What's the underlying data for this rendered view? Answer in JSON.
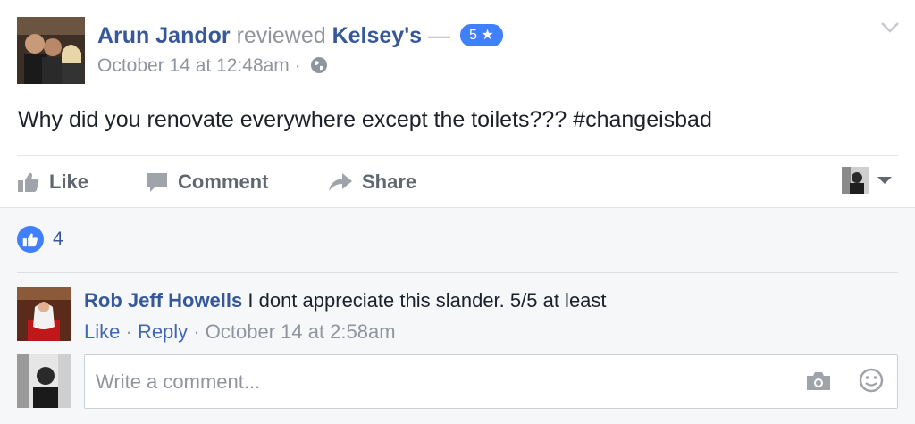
{
  "post": {
    "author": "Arun Jandor",
    "action": "reviewed",
    "place": "Kelsey's",
    "separator": "—",
    "rating": "5",
    "rating_icon": "star-icon",
    "timestamp": "October 14 at 12:48am",
    "meta_separator": "·",
    "audience_icon": "globe-icon",
    "text": "Why did you renovate everywhere except the toilets??? #changeisbad",
    "options_icon": "chevron-down-icon"
  },
  "actions": {
    "like": "Like",
    "comment": "Comment",
    "share": "Share"
  },
  "reactions": {
    "icon": "thumbs-up-icon",
    "count": "4"
  },
  "comments": [
    {
      "author": "Rob Jeff Howells",
      "text": "I dont appreciate this slander. 5/5 at least",
      "like": "Like",
      "reply": "Reply",
      "timestamp": "October 14 at 2:58am"
    }
  ],
  "composer": {
    "placeholder": "Write a comment...",
    "camera_icon": "camera-icon",
    "emoji_icon": "smiley-icon"
  },
  "colors": {
    "link_blue": "#365899",
    "badge_blue": "#4080ff",
    "meta_grey": "#90949c",
    "action_grey": "#606770",
    "footer_bg": "#f6f7f9"
  }
}
